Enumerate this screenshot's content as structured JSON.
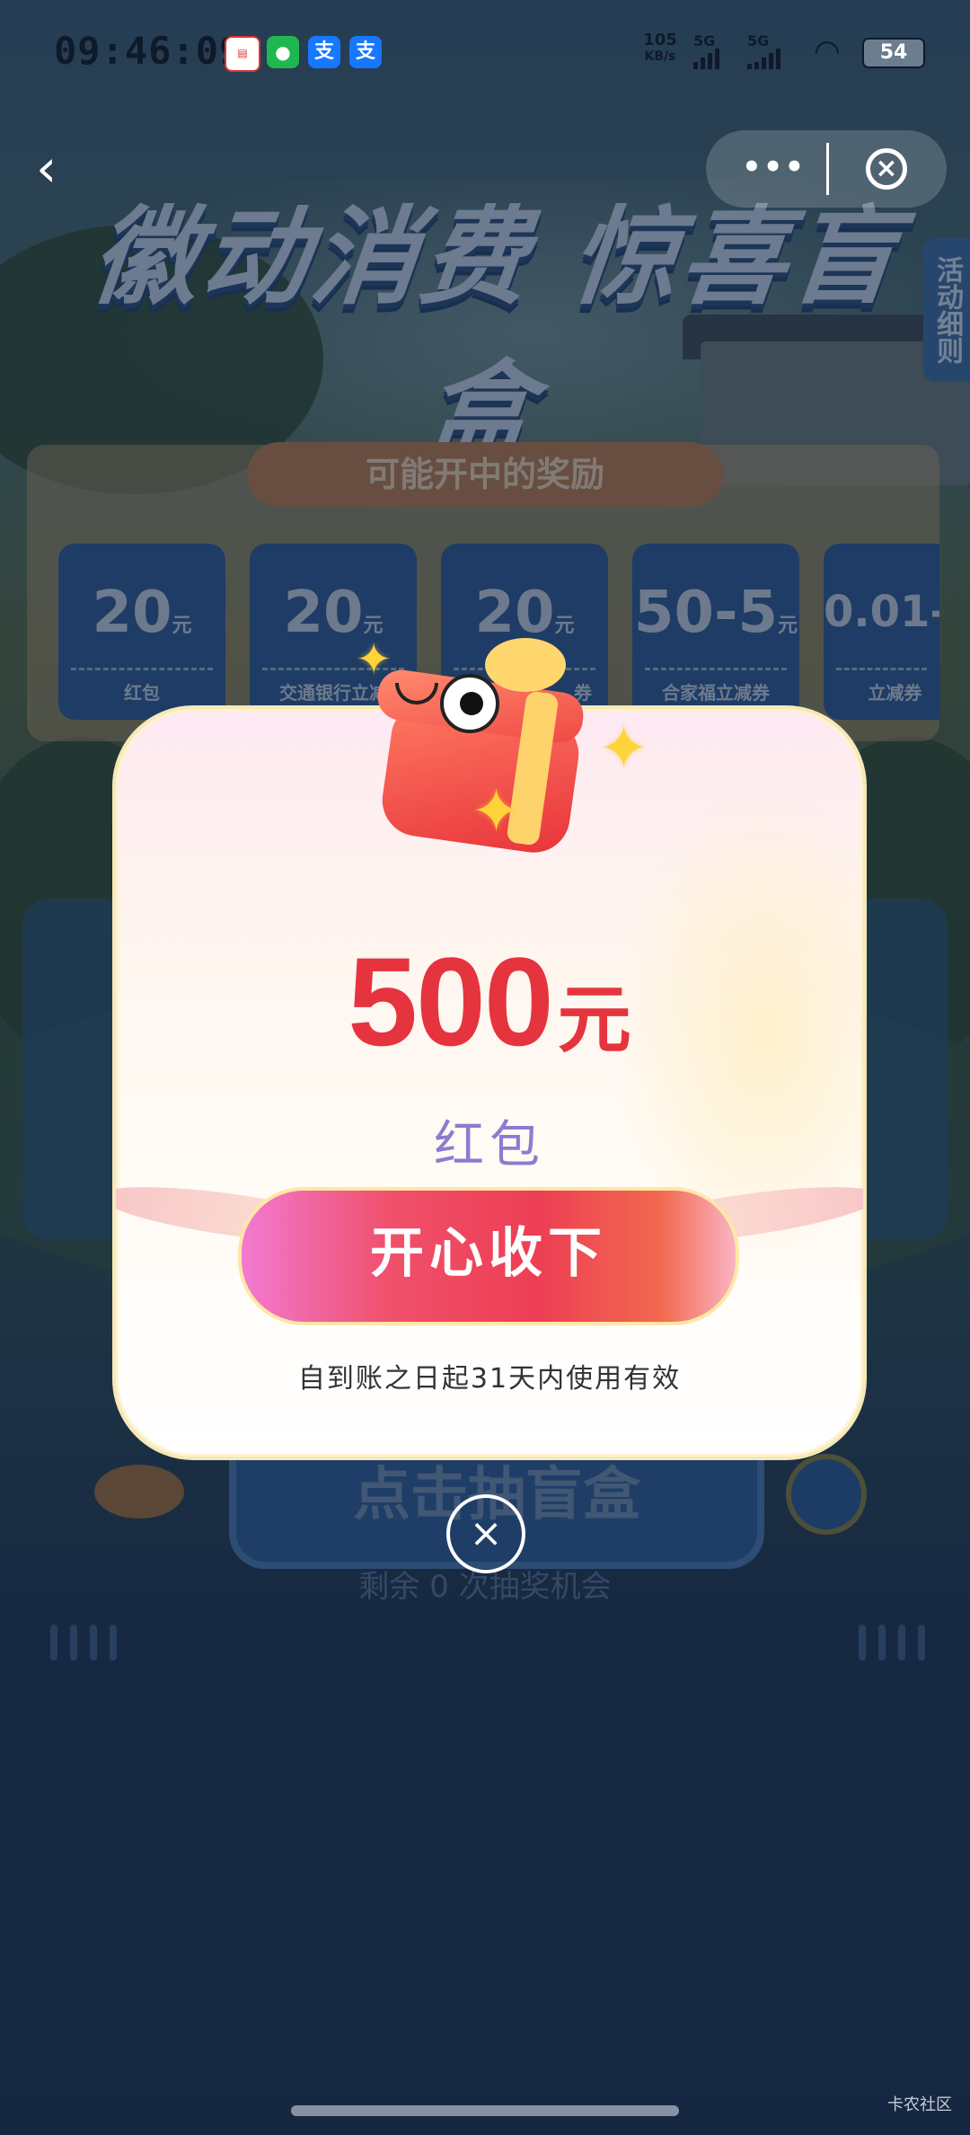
{
  "status_bar": {
    "time": "09:46:09",
    "net_speed_value": "105",
    "net_speed_unit": "KB/s",
    "signal_1": "5G",
    "signal_2": "5G",
    "battery": "54",
    "app_icons": [
      "unionpay-icon",
      "wechat-icon",
      "alipay-icon",
      "alipay-icon"
    ],
    "app_icon_glyphs": [
      "",
      "",
      "支",
      "支"
    ]
  },
  "nav": {
    "back_glyph": "‹",
    "more_glyph": "•••",
    "close_glyph": "×"
  },
  "banner": {
    "title": "徽动消费 惊喜盲盒",
    "rules_tab": "活动细则"
  },
  "prize_list": {
    "header": "可能开中的奖励",
    "items": [
      {
        "amount": "20",
        "unit": "元",
        "label": "红包"
      },
      {
        "amount": "20",
        "unit": "元",
        "label": "交通银行立减"
      },
      {
        "amount": "20",
        "unit": "元",
        "label": "券"
      },
      {
        "amount": "50-5",
        "unit": "元",
        "label": "合家福立减券"
      },
      {
        "amount": "0.01-",
        "unit": "",
        "label": "立减券"
      }
    ]
  },
  "machine": {
    "draw_button": "点击抽盲盒",
    "remaining_text": "剩余 0 次抽奖机会"
  },
  "modal": {
    "amount": "500",
    "unit": "元",
    "prize_type": "红包",
    "claim_button": "开心收下",
    "validity": "自到账之日起31天内使用有效",
    "close_glyph": "×"
  },
  "watermark": "卡农社区",
  "colors": {
    "amount_red": "#e6343e",
    "prize_type_purple": "#8d7bd0",
    "overlay": "#101e34"
  }
}
